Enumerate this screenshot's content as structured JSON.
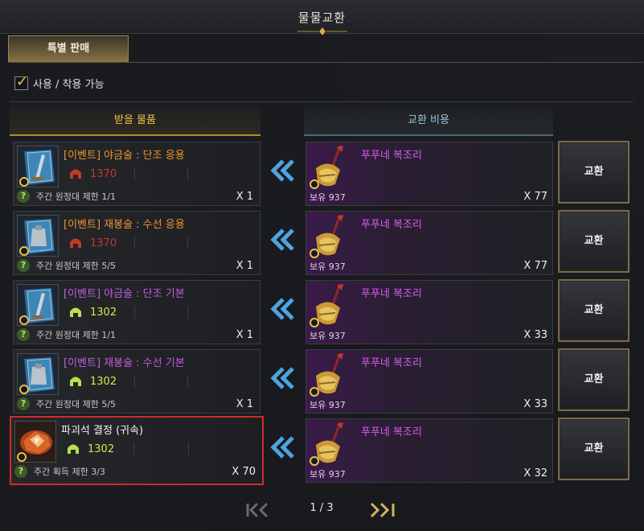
{
  "window": {
    "title": "물물교환"
  },
  "tabs": [
    {
      "label": "특별 판매",
      "active": true
    }
  ],
  "filter": {
    "label": "사용 / 착용 가능",
    "checked": true
  },
  "headers": {
    "receive": "받을 물품",
    "cost": "교환 비용"
  },
  "rows": [
    {
      "name": "[이벤트] 야금술 : 단조 응용",
      "name_color": "#f0962c",
      "power": "1370",
      "power_color": "#c0392b",
      "helmet_color": "#c0392b",
      "limit": "주간 원정대 제한 1/1",
      "qty": "X 1",
      "icon": "blue-book-sword-icon",
      "cost": {
        "name": "푸푸네 복조리",
        "owned": "보유 937",
        "qty": "X 77"
      },
      "button": "교환"
    },
    {
      "name": "[이벤트] 재봉술 : 수선 응용",
      "name_color": "#f0962c",
      "power": "1370",
      "power_color": "#c0392b",
      "helmet_color": "#c0392b",
      "limit": "주간 원정대 제한 5/5",
      "qty": "X 1",
      "icon": "blue-book-armor-icon",
      "cost": {
        "name": "푸푸네 복조리",
        "owned": "보유 937",
        "qty": "X 77"
      },
      "button": "교환"
    },
    {
      "name": "[이벤트] 야금술 : 단조 기본",
      "name_color": "#c25ee0",
      "power": "1302",
      "power_color": "#d4e84a",
      "helmet_color": "#b7e04a",
      "limit": "주간 원정대 제한 1/1",
      "qty": "X 1",
      "icon": "blue-book-sword-icon",
      "cost": {
        "name": "푸푸네 복조리",
        "owned": "보유 937",
        "qty": "X 33"
      },
      "button": "교환"
    },
    {
      "name": "[이벤트] 재봉술 : 수선 기본",
      "name_color": "#c25ee0",
      "power": "1302",
      "power_color": "#d4e84a",
      "helmet_color": "#b7e04a",
      "limit": "주간 원정대 제한 5/5",
      "qty": "X 1",
      "icon": "blue-book-armor-icon",
      "cost": {
        "name": "푸푸네 복조리",
        "owned": "보유 937",
        "qty": "X 33"
      },
      "button": "교환"
    },
    {
      "name": "파괴석 결정 (귀속)",
      "name_color": "#f2f2f2",
      "power": "1302",
      "power_color": "#d4e84a",
      "helmet_color": "#b7e04a",
      "limit": "주간 획득 제한 3/3",
      "qty": "X 70",
      "icon": "destruction-stone-crystal-icon",
      "cost": {
        "name": "푸푸네 복조리",
        "owned": "보유 937",
        "qty": "X 32"
      },
      "button": "교환"
    }
  ],
  "pagination": {
    "text": "1 / 3"
  },
  "colors": {
    "accent_gold": "#b58a2e",
    "cost_purple": "#d95cf0",
    "arrow_blue": "#4fa3e0",
    "highlight_red": "#d42a2a"
  }
}
